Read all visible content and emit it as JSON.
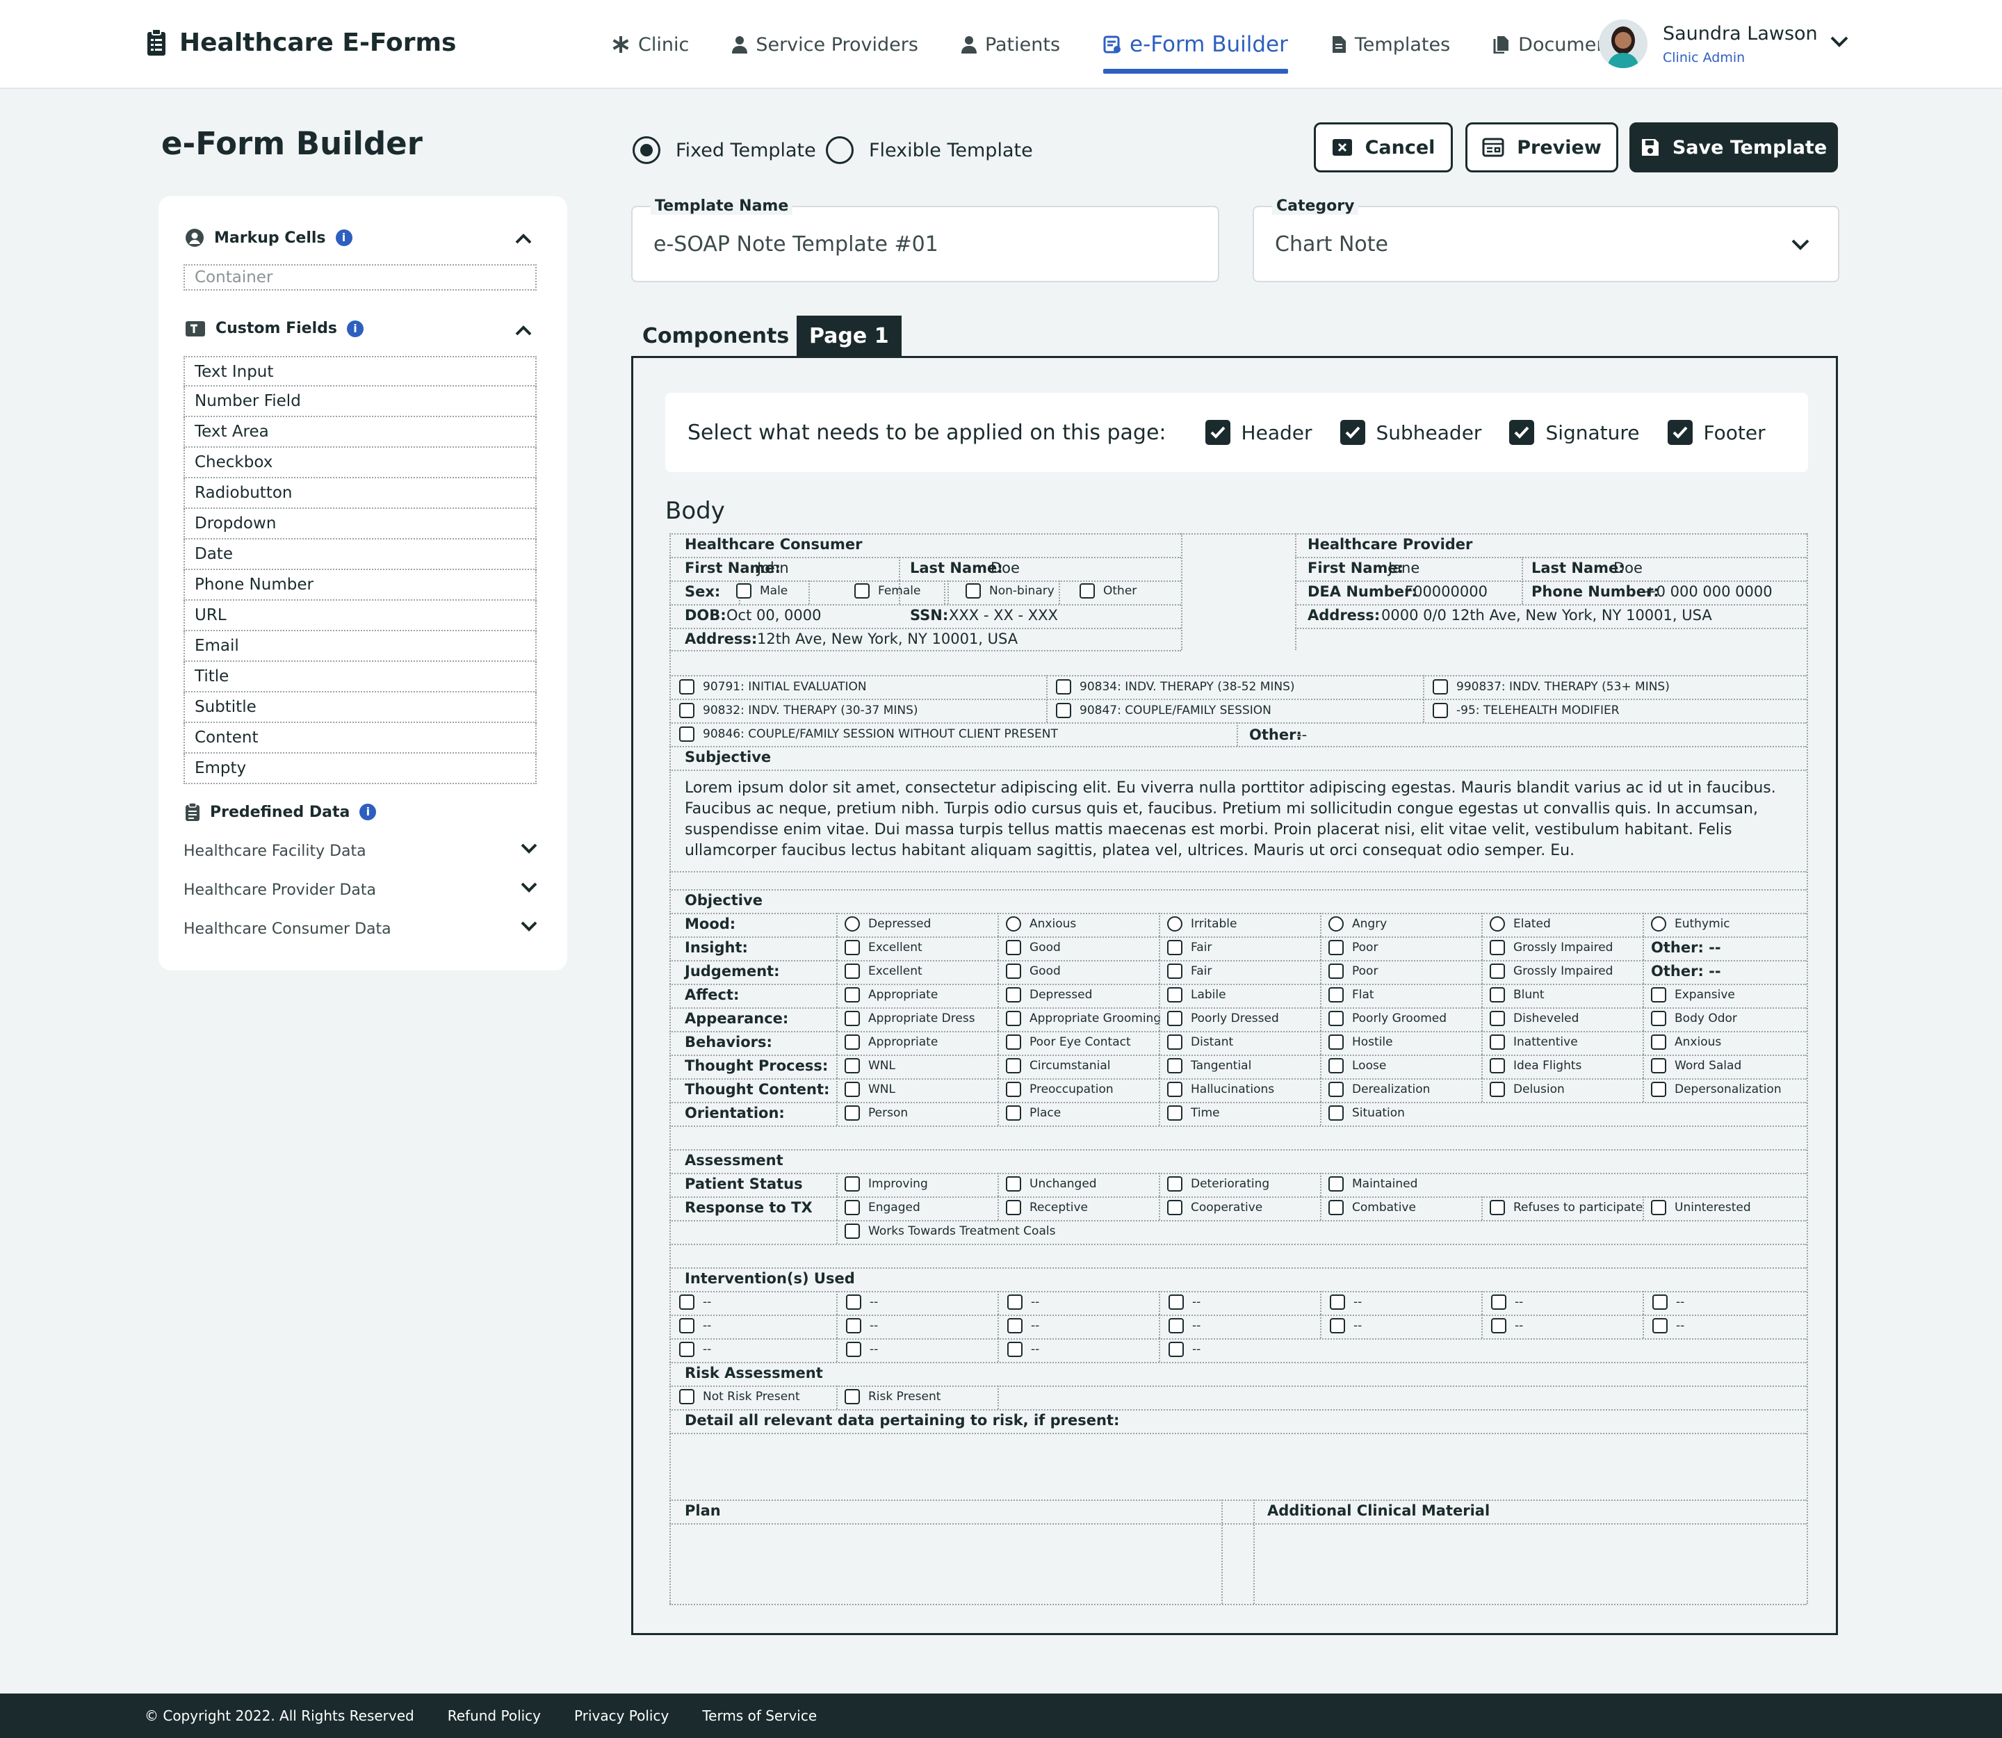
{
  "app": {
    "brand": "Healthcare E-Forms"
  },
  "nav": {
    "items": [
      {
        "label": "Clinic",
        "icon": "asterisk-icon"
      },
      {
        "label": "Service Providers",
        "icon": "person-icon"
      },
      {
        "label": "Patients",
        "icon": "person-icon"
      },
      {
        "label": "e-Form Builder",
        "icon": "form-icon",
        "active": true
      },
      {
        "label": "Templates",
        "icon": "document-icon"
      },
      {
        "label": "Documents",
        "icon": "documents-icon"
      }
    ]
  },
  "user": {
    "name": "Saundra Lawson",
    "role": "Clinic Admin"
  },
  "page": {
    "title": "e-Form Builder"
  },
  "template_mode": {
    "fixed": "Fixed Template",
    "flexible": "Flexible Template",
    "selected": "Fixed Template"
  },
  "actions": {
    "cancel": "Cancel",
    "preview": "Preview",
    "save": "Save Template"
  },
  "fields": {
    "template_name_label": "Template Name",
    "template_name": "e-SOAP Note Template #01",
    "category_label": "Category",
    "category": "Chart Note"
  },
  "tabs": {
    "components": "Components",
    "page1": "Page 1"
  },
  "sidebar": {
    "markup_title": "Markup Cells",
    "container": "Container",
    "custom_title": "Custom Fields",
    "custom_fields": [
      "Text Input",
      "Number Field",
      "Text Area",
      "Checkbox",
      "Radiobutton",
      "Dropdown",
      "Date",
      "Phone Number",
      "URL",
      "Email",
      "Title",
      "Subtitle",
      "Content",
      "Empty"
    ],
    "predefined_title": "Predefined Data",
    "predefined": [
      "Healthcare Facility Data",
      "Healthcare Provider Data",
      "Healthcare Consumer Data"
    ]
  },
  "apply": {
    "question": "Select what needs to be applied on this page:",
    "options": [
      {
        "label": "Header",
        "checked": true
      },
      {
        "label": "Subheader",
        "checked": true
      },
      {
        "label": "Signature",
        "checked": true
      },
      {
        "label": "Footer",
        "checked": true
      }
    ]
  },
  "form": {
    "body_title": "Body",
    "consumer": {
      "title": "Healthcare Consumer",
      "first_label": "First Name:",
      "first": "John",
      "last_label": "Last Name:",
      "last": "Doe",
      "sex_label": "Sex:",
      "sex_opts": [
        "Male",
        "Female",
        "Non-binary",
        "Other"
      ],
      "dob_label": "DOB:",
      "dob": "Oct 00, 0000",
      "ssn_label": "SSN:",
      "ssn": "XXX - XX - XXX",
      "address_label": "Address:",
      "address": "12th Ave, New York, NY 10001, USA"
    },
    "provider": {
      "title": "Healthcare Provider",
      "first_label": "First Name:",
      "first": "Jane",
      "last_label": "Last Name:",
      "last": "Doe",
      "dea_label": "DEA Number:",
      "dea": "F00000000",
      "phone_label": "Phone Number:",
      "phone": "+0 000 000 0000",
      "address_label": "Address:",
      "address": "0000 0/0 12th Ave, New York, NY 10001, USA"
    },
    "codes": [
      "90791: INITIAL EVALUATION",
      "90834: INDV. THERAPY (38-52 MINS)",
      "990837: INDV. THERAPY (53+ MINS)",
      "90832: INDV. THERAPY (30-37 MINS)",
      "90847: COUPLE/FAMILY SESSION",
      "-95: TELEHEALTH MODIFIER",
      "90846: COUPLE/FAMILY SESSION WITHOUT CLIENT PRESENT"
    ],
    "codes_other_label": "Other:",
    "codes_other": "--",
    "subjective_title": "Subjective",
    "subjective_text": "Lorem ipsum dolor sit amet, consectetur adipiscing elit. Eu viverra nulla porttitor adipiscing egestas. Mauris blandit varius ac id ut in faucibus. Faucibus ac neque, pretium nibh. Turpis odio cursus quis et, faucibus. Pretium mi sollicitudin congue egestas ut convallis quis. In accumsan, suspendisse enim vitae. Dui massa turpis tellus mattis maecenas est morbi. Proin placerat nisi, elit vitae velit, vestibulum habitant. Felis ullamcorper faucibus lectus habitant aliquam sagittis, platea vel, ultrices. Mauris ut orci consequat odio semper. Eu.",
    "objective_title": "Objective",
    "objective": [
      {
        "label": "Mood:",
        "opts": [
          "Depressed",
          "Anxious",
          "Irritable",
          "Angry",
          "Elated",
          "Euthymic"
        ],
        "kind": "radio"
      },
      {
        "label": "Insight:",
        "opts": [
          "Excellent",
          "Good",
          "Fair",
          "Poor",
          "Grossly Impaired"
        ],
        "other": "Other: --"
      },
      {
        "label": "Judgement:",
        "opts": [
          "Excellent",
          "Good",
          "Fair",
          "Poor",
          "Grossly Impaired"
        ],
        "other": "Other: --"
      },
      {
        "label": "Affect:",
        "opts": [
          "Appropriate",
          "Depressed",
          "Labile",
          "Flat",
          "Blunt",
          "Expansive"
        ]
      },
      {
        "label": "Appearance:",
        "opts": [
          "Appropriate Dress",
          "Appropriate Grooming",
          "Poorly Dressed",
          "Poorly Groomed",
          "Disheveled",
          "Body Odor"
        ]
      },
      {
        "label": "Behaviors:",
        "opts": [
          "Appropriate",
          "Poor Eye Contact",
          "Distant",
          "Hostile",
          "Inattentive",
          "Anxious"
        ]
      },
      {
        "label": "Thought Process:",
        "opts": [
          "WNL",
          "Circumstanial",
          "Tangential",
          "Loose",
          "Idea Flights",
          "Word Salad"
        ]
      },
      {
        "label": "Thought Content:",
        "opts": [
          "WNL",
          "Preoccupation",
          "Hallucinations",
          "Derealization",
          "Delusion",
          "Depersonalization"
        ]
      },
      {
        "label": "Orientation:",
        "opts": [
          "Person",
          "Place",
          "Time",
          "Situation"
        ]
      }
    ],
    "assessment_title": "Assessment",
    "patient_status_label": "Patient Status",
    "patient_status": [
      "Improving",
      "Unchanged",
      "Deteriorating",
      "Maintained"
    ],
    "response_label": "Response to TX",
    "response": [
      "Engaged",
      "Receptive",
      "Cooperative",
      "Combative",
      "Refuses to participate",
      "Uninterested"
    ],
    "response_extra": "Works Towards Treatment Coals",
    "intervention_title": "Intervention(s) Used",
    "intervention_placeholder": "--",
    "risk_title": "Risk Assessment",
    "risk_opts": [
      "Not Risk Present",
      "Risk Present"
    ],
    "risk_detail": "Detail all relevant data pertaining to risk, if present:",
    "plan_title": "Plan",
    "additional_title": "Additional Clinical Material"
  },
  "footer": {
    "copyright": "© Copyright 2022. All Rights Reserved",
    "links": [
      "Refund Policy",
      "Privacy Policy",
      "Terms of Service"
    ]
  }
}
